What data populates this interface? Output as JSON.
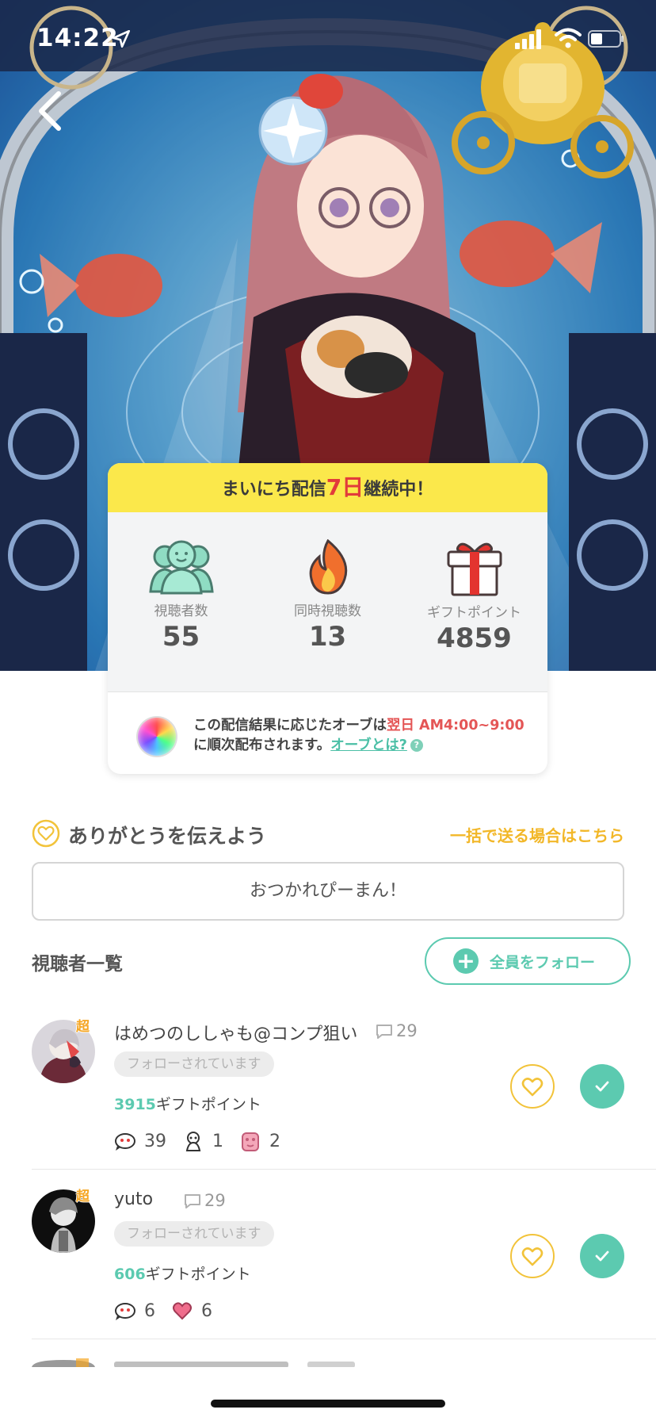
{
  "status_bar": {
    "time": "14:22"
  },
  "streak_card": {
    "banner_prefix": "まいにち配信",
    "banner_days": "7日",
    "banner_suffix": "継続中！",
    "stats": [
      {
        "label": "視聴者数",
        "value": "55",
        "icon": "viewers-icon"
      },
      {
        "label": "同時視聴数",
        "value": "13",
        "icon": "flame-icon"
      },
      {
        "label": "ギフトポイント",
        "value": "4859",
        "icon": "gift-icon"
      }
    ],
    "note_line1_a": "この配信結果に応じたオーブは",
    "note_line1_b": "翌日 AM4:00~9:00",
    "note_line2_a": "に順次配布されます。",
    "note_link": "オーブとは?",
    "help_mark": "?"
  },
  "thanks": {
    "title": "ありがとうを伝えよう",
    "bulk_link": "一括で送る場合はこちら",
    "message": "おつかれぴーまん！"
  },
  "viewers": {
    "title": "視聴者一覧",
    "follow_all": "全員をフォロー",
    "items": [
      {
        "name": "はめつのししゃも@コンプ狙い",
        "comments": "29",
        "tier": "超",
        "follow_status": "フォローされています",
        "gift_points": "3915",
        "gift_points_suffix": "ギフトポイント",
        "gifts": [
          {
            "icon": "ghost-gift-icon",
            "count": "39"
          },
          {
            "icon": "skull-gift-icon",
            "count": "1"
          },
          {
            "icon": "pink-bear-gift-icon",
            "count": "2"
          }
        ]
      },
      {
        "name": "yuto",
        "comments": "29",
        "tier": "超",
        "follow_status": "フォローされています",
        "gift_points": "606",
        "gift_points_suffix": "ギフトポイント",
        "gifts": [
          {
            "icon": "ghost-gift-icon",
            "count": "6"
          },
          {
            "icon": "heart-gift-icon",
            "count": "6"
          }
        ]
      }
    ]
  },
  "colors": {
    "accent_green": "#5ccab0",
    "accent_yellow": "#f2c33a",
    "banner_yellow": "#fbe84b",
    "highlight_red": "#e23b3b"
  }
}
